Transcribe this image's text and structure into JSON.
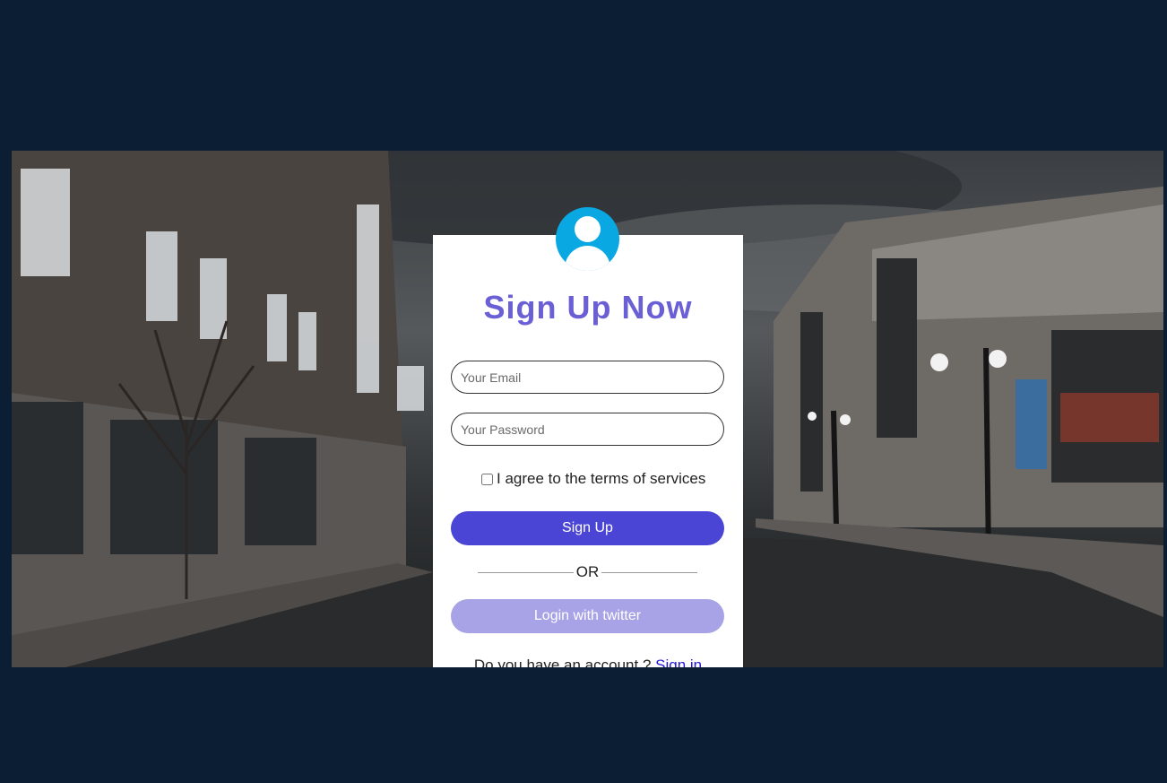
{
  "form": {
    "title": "Sign Up Now",
    "email_placeholder": "Your Email",
    "password_placeholder": "Your Password",
    "agree_label": "I agree to the terms of services",
    "signup_label": "Sign Up",
    "or_label": "OR",
    "twitter_label": "Login with twitter",
    "account_prompt": "Do you have an account ?",
    "signin_link": "Sign in"
  },
  "colors": {
    "page_background": "#0c1e33",
    "title": "#6b5fd6",
    "signup_button": "#4a45d4",
    "twitter_button": "#a7a3e6",
    "avatar": "#0aa8e2",
    "link": "#2418d8"
  },
  "icons": {
    "avatar": "user-avatar-icon"
  }
}
